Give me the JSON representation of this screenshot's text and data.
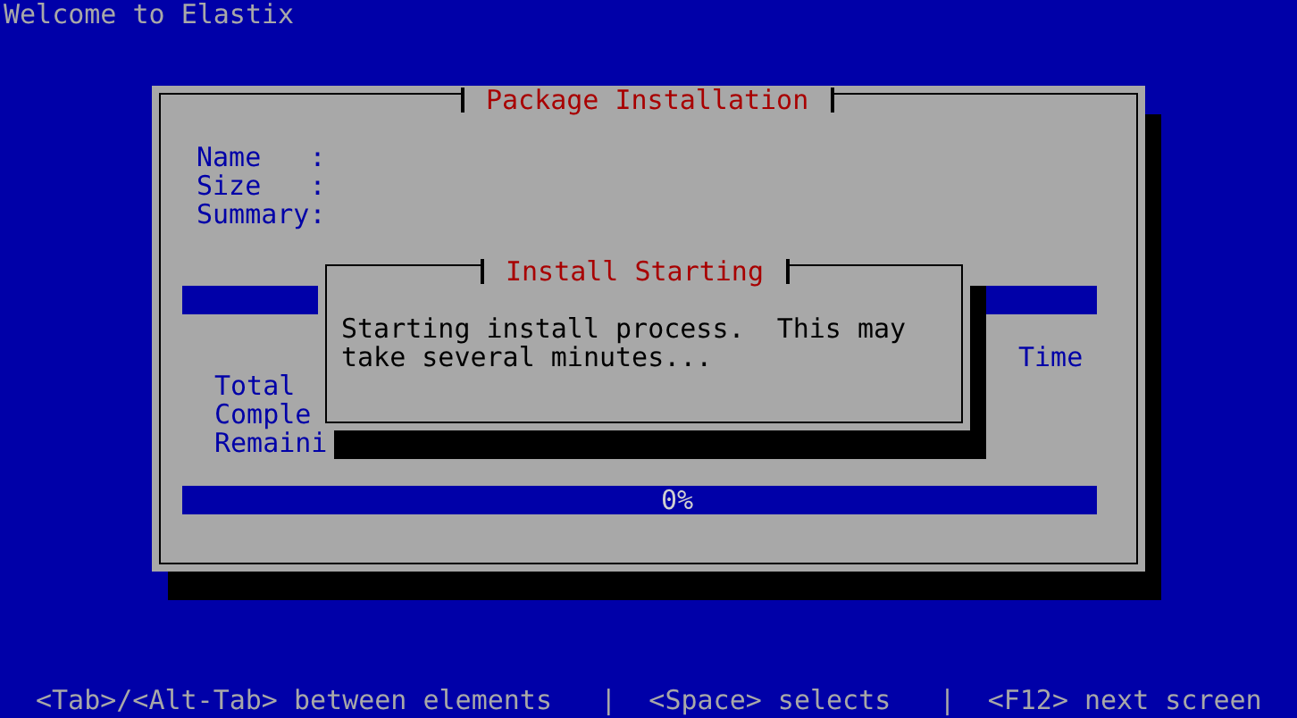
{
  "header": {
    "title": "Welcome to Elastix"
  },
  "package_dialog": {
    "title": "Package Installation",
    "fields": [
      {
        "label": "Name   :"
      },
      {
        "label": "Size   :"
      },
      {
        "label": "Summary:"
      }
    ],
    "package_progress": {
      "level": 0
    },
    "stats": {
      "column_header": "Time",
      "rows": [
        {
          "label": "Total"
        },
        {
          "label": "Comple"
        },
        {
          "label": "Remaini"
        }
      ]
    },
    "overall_progress": {
      "level": 0,
      "reading": "0%"
    }
  },
  "message_dialog": {
    "title": "Install Starting",
    "message": "Starting install process.  This may take several minutes..."
  },
  "status_bar": {
    "text": "<Tab>/<Alt-Tab> between elements   |  <Space> selects   |  <F12> next screen"
  }
}
